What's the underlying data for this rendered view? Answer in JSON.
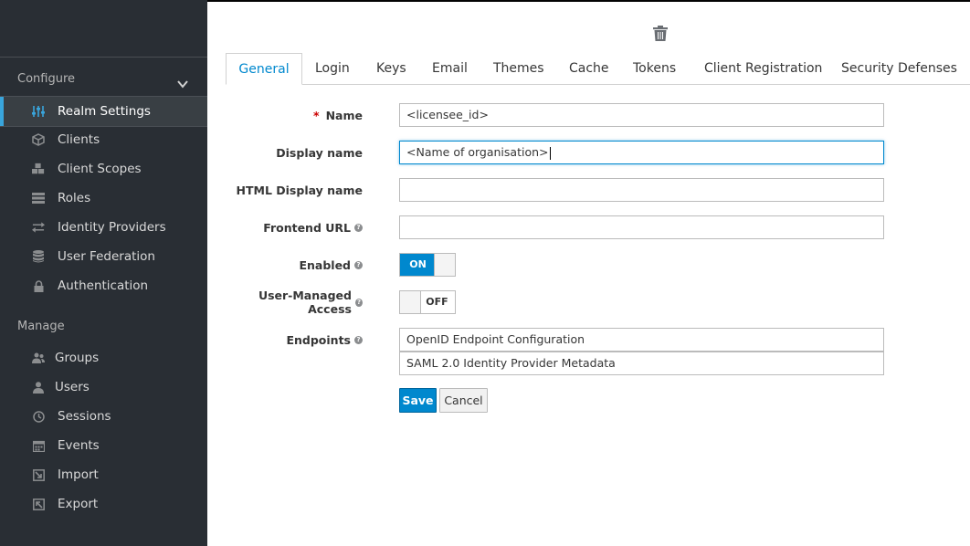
{
  "sidebar": {
    "configure_label": "Configure",
    "manage_label": "Manage",
    "configure_items": [
      {
        "label": "Realm Settings",
        "icon": "sliders-icon"
      },
      {
        "label": "Clients",
        "icon": "cube-icon"
      },
      {
        "label": "Client Scopes",
        "icon": "cubes-icon"
      },
      {
        "label": "Roles",
        "icon": "list-icon"
      },
      {
        "label": "Identity Providers",
        "icon": "exchange-icon"
      },
      {
        "label": "User Federation",
        "icon": "database-icon"
      },
      {
        "label": "Authentication",
        "icon": "lock-icon"
      }
    ],
    "manage_items": [
      {
        "label": "Groups",
        "icon": "users-icon"
      },
      {
        "label": "Users",
        "icon": "user-icon"
      },
      {
        "label": "Sessions",
        "icon": "clock-icon"
      },
      {
        "label": "Events",
        "icon": "calendar-icon"
      },
      {
        "label": "Import",
        "icon": "import-icon"
      },
      {
        "label": "Export",
        "icon": "export-icon"
      }
    ],
    "active_item": "Realm Settings"
  },
  "tabs": [
    "General",
    "Login",
    "Keys",
    "Email",
    "Themes",
    "Cache",
    "Tokens",
    "Client Registration",
    "Security Defenses"
  ],
  "active_tab": "General",
  "form": {
    "name_label": "Name",
    "name_value": "<licensee_id>",
    "display_name_label": "Display name",
    "display_name_value": "<Name of organisation>",
    "html_display_name_label": "HTML Display name",
    "html_display_name_value": "",
    "frontend_url_label": "Frontend URL",
    "frontend_url_value": "",
    "enabled_label": "Enabled",
    "enabled_state": "ON",
    "user_managed_access_label": "User-Managed Access",
    "user_managed_access_state": "OFF",
    "endpoints_label": "Endpoints",
    "endpoint_1": "OpenID Endpoint Configuration",
    "endpoint_2": "SAML 2.0 Identity Provider Metadata",
    "save_label": "Save",
    "cancel_label": "Cancel"
  },
  "colors": {
    "sidebar_bg": "#292e34",
    "accent": "#0088ce",
    "active_bar": "#39a5dc",
    "required": "#cc0000"
  }
}
